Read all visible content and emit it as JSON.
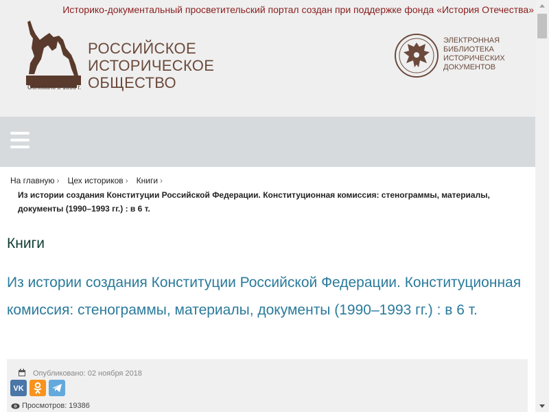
{
  "header": {
    "topline": "Историко-документальный просветительский портал создан при поддержке фонда «История Отечества»",
    "rio": {
      "line1": "РОССИЙСКОЕ",
      "line2": "ИСТОРИЧЕСКОЕ",
      "line3": "ОБЩЕСТВО",
      "founded": "Основано в 1866 г."
    },
    "library": {
      "line1": "ЭЛЕКТРОННАЯ",
      "line2": "БИБЛИОТЕКА",
      "line3": "ИСТОРИЧЕСКИХ",
      "line4": "ДОКУМЕНТОВ"
    }
  },
  "breadcrumb": {
    "items": [
      "На главную",
      "Цех историков",
      "Книги"
    ],
    "current": "Из истории создания Конституции Российской Федерации. Конституционная комиссия: стенограммы, материалы, документы (1990–1993 гг.) : в 6 т."
  },
  "section_title": "Книги",
  "article": {
    "title": "Из истории создания Конституции Российской Федерации. Конституционная комиссия: стенограммы, материалы, документы (1990–1993 гг.) : в 6 т.",
    "published": "Опубликовано: 02 ноября 2018",
    "views": "Просмотров: 19386"
  },
  "share": {
    "vk_icon": "vk-icon",
    "ok_icon": "odnoklassniki-icon",
    "tg_icon": "telegram-icon"
  },
  "colors": {
    "brand_red": "#8a1c1c",
    "link_blue": "#2a7a9b",
    "section_green": "#0e3d33",
    "nav_bg": "#d6dadd"
  }
}
